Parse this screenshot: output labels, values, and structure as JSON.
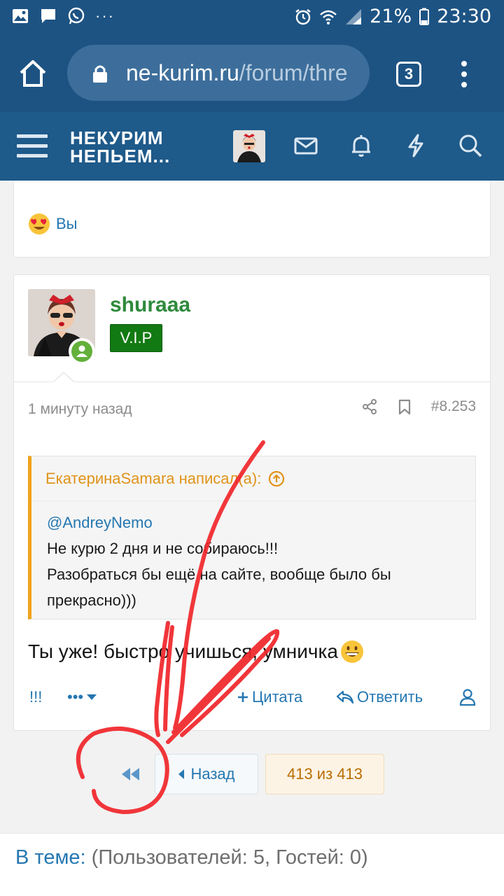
{
  "status_bar": {
    "battery_percent": "21%",
    "time": "23:30",
    "overflow": "···"
  },
  "browser": {
    "url_domain": "ne-kurim.ru",
    "url_path": "/forum/thre",
    "tab_count": "3"
  },
  "site": {
    "logo_line1": "НЕКУРИМ",
    "logo_line2": "НЕПЬЕМ..."
  },
  "reaction": {
    "label": "Вы"
  },
  "post": {
    "author": "shuraaa",
    "badge": "V.I.P",
    "time": "1 минуту назад",
    "number": "#8.253",
    "quote": {
      "header": "ЕкатеринаSamara написал(а):",
      "mention": "@AndreyNemo",
      "line1": "Не курю 2 дня и не собираюсь!!!",
      "line2": "Разобраться бы ещё на сайте, вообще было бы",
      "line3": "прекрасно)))"
    },
    "text": "Ты уже! быстро учишься, умничка",
    "actions": {
      "report": "!!!",
      "more": "•••",
      "quote": "Цитата",
      "reply": "Ответить"
    }
  },
  "pager": {
    "prev_label": "Назад",
    "count_label": "413 из 413"
  },
  "footer": {
    "label": "В теме:",
    "value": " (Пользователей: 5, Гостей: 0)"
  }
}
